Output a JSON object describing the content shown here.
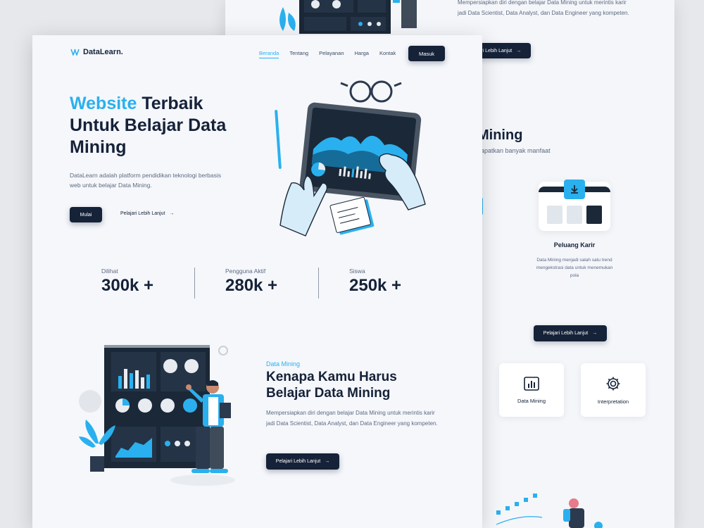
{
  "colors": {
    "accent": "#2ab0ee",
    "navy": "#152238",
    "page_bg": "#f5f7fb",
    "muted_text": "#5d6a80"
  },
  "back_page": {
    "top_text": "Mempersiapkan diri dengan belajar Data Mining untuk merintis karir jadi Data Scientist, Data Analyst, dan Data Engineer yang kompeten.",
    "top_button": "Pelajari Lebih Lanjut",
    "heading": "Mining",
    "subheading": "dapatkan banyak manfaat",
    "career_card": {
      "title": "Peluang Karir",
      "desc": "Data Mining menjadi salah satu trend mengekstrasi data untuk menemukan pola"
    },
    "mid_button": "Pelajari Lebih Lanjut",
    "features": [
      {
        "label": "Data Mining",
        "icon": "bar-chart-icon"
      },
      {
        "label": "Interpretation",
        "icon": "gear-icon"
      }
    ]
  },
  "front_page": {
    "logo": "DataLearn.",
    "nav": {
      "items": [
        "Beranda",
        "Tentang",
        "Pelayanan",
        "Harga",
        "Kontak"
      ],
      "active": "Beranda",
      "login": "Masuk"
    },
    "hero": {
      "title_highlight": "Website",
      "title_rest": " Terbaik Untuk Belajar Data Mining",
      "desc": "DataLearn adalah platform pendidikan teknologi berbasis web untuk belajar Data Mining.",
      "primary_button": "Mulai",
      "secondary_link": "Pelajari Lebih Lanjut"
    },
    "stats": [
      {
        "label": "Dilihat",
        "value": "300k +"
      },
      {
        "label": "Pengguna Aktif",
        "value": "280k +"
      },
      {
        "label": "Siswa",
        "value": "250k +"
      }
    ],
    "section2": {
      "tag": "Data Mining",
      "title": "Kenapa Kamu Harus Belajar Data Mining",
      "desc": "Mempersiapkan diri dengan belajar Data Mining untuk merintis karir jadi Data Scientist, Data Analyst, dan Data Engineer yang kompeten.",
      "button": "Pelajari Lebih Lanjut"
    }
  }
}
